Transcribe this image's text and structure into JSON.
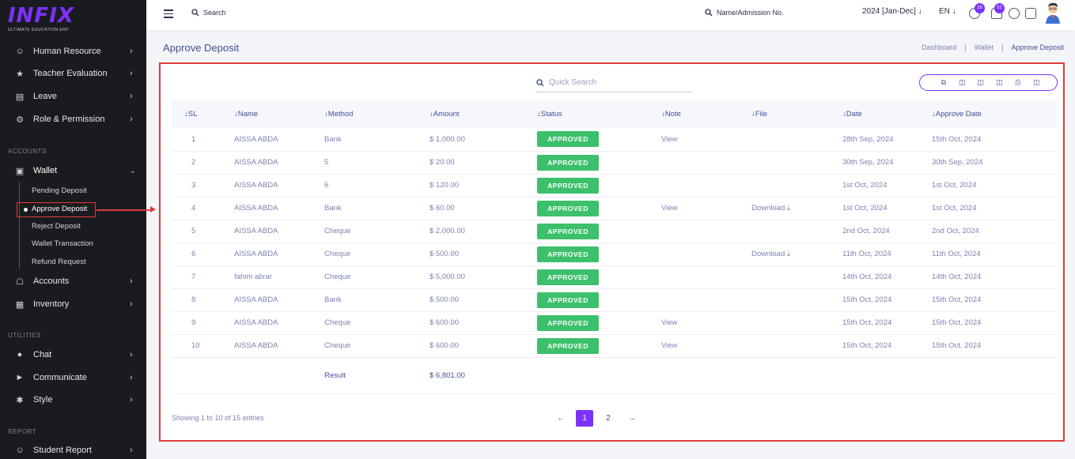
{
  "brand": {
    "name": "INFIX",
    "tagline": "ULTIMATE EDUCATION ERP",
    "accent": "#7c32ff"
  },
  "sidebar": {
    "items_top": [
      {
        "label": "Human Resource",
        "icon": "users-icon"
      },
      {
        "label": "Teacher Evaluation",
        "icon": "star-icon"
      },
      {
        "label": "Leave",
        "icon": "bed-icon"
      },
      {
        "label": "Role & Permission",
        "icon": "key-icon"
      }
    ],
    "section_accounts": "ACCOUNTS",
    "wallet": {
      "label": "Wallet",
      "icon": "wallet-icon"
    },
    "wallet_sub": [
      "Pending Deposit",
      "Approve Deposit",
      "Reject Deposit",
      "Wallet Transaction",
      "Refund Request"
    ],
    "items_accounts": [
      {
        "label": "Accounts",
        "icon": "bank-icon"
      },
      {
        "label": "Inventory",
        "icon": "box-icon"
      }
    ],
    "section_utilities": "UTILITIES",
    "items_utilities": [
      {
        "label": "Chat",
        "icon": "chat-icon"
      },
      {
        "label": "Communicate",
        "icon": "megaphone-icon"
      },
      {
        "label": "Style",
        "icon": "style-icon"
      }
    ],
    "section_report": "REPORT",
    "items_report": [
      {
        "label": "Student Report",
        "icon": "users-icon"
      }
    ]
  },
  "topbar": {
    "search_label": "Search",
    "student_search": "Name/Admission No.",
    "session": "2024 [Jan-Dec]",
    "language": "EN",
    "chat_count": "16",
    "notification_count": "52"
  },
  "page": {
    "title": "Approve Deposit",
    "breadcrumb": [
      "Dashboard",
      "Wallet",
      "Approve Deposit"
    ]
  },
  "table": {
    "quick_search_placeholder": "Quick Search",
    "headers": [
      "SL",
      "Name",
      "Method",
      "Amount",
      "Status",
      "Note",
      "File",
      "Date",
      "Approve Date"
    ],
    "rows": [
      {
        "sl": "1",
        "name": "AISSA ABDA",
        "method": "Bank",
        "amount": "$ 1,000.00",
        "status": "APPROVED",
        "note": "View",
        "file": "",
        "date": "28th Sep, 2024",
        "approve_date": "15th Oct, 2024"
      },
      {
        "sl": "2",
        "name": "AISSA ABDA",
        "method": "5",
        "amount": "$ 20.00",
        "status": "APPROVED",
        "note": "",
        "file": "",
        "date": "30th Sep, 2024",
        "approve_date": "30th Sep, 2024"
      },
      {
        "sl": "3",
        "name": "AISSA ABDA",
        "method": "6",
        "amount": "$ 120.00",
        "status": "APPROVED",
        "note": "",
        "file": "",
        "date": "1st Oct, 2024",
        "approve_date": "1st Oct, 2024"
      },
      {
        "sl": "4",
        "name": "AISSA ABDA",
        "method": "Bank",
        "amount": "$ 60.00",
        "status": "APPROVED",
        "note": "View",
        "file": "Download",
        "date": "1st Oct, 2024",
        "approve_date": "1st Oct, 2024"
      },
      {
        "sl": "5",
        "name": "AISSA ABDA",
        "method": "Cheque",
        "amount": "$ 2,000.00",
        "status": "APPROVED",
        "note": "",
        "file": "",
        "date": "2nd Oct, 2024",
        "approve_date": "2nd Oct, 2024"
      },
      {
        "sl": "6",
        "name": "AISSA ABDA",
        "method": "Cheque",
        "amount": "$ 500.00",
        "status": "APPROVED",
        "note": "",
        "file": "Download",
        "date": "11th Oct, 2024",
        "approve_date": "11th Oct, 2024"
      },
      {
        "sl": "7",
        "name": "fahim abrar",
        "method": "Cheque",
        "amount": "$ 5,000.00",
        "status": "APPROVED",
        "note": "",
        "file": "",
        "date": "14th Oct, 2024",
        "approve_date": "14th Oct, 2024"
      },
      {
        "sl": "8",
        "name": "AISSA ABDA",
        "method": "Bank",
        "amount": "$ 500.00",
        "status": "APPROVED",
        "note": "",
        "file": "",
        "date": "15th Oct, 2024",
        "approve_date": "15th Oct, 2024"
      },
      {
        "sl": "9",
        "name": "AISSA ABDA",
        "method": "Cheque",
        "amount": "$ 600.00",
        "status": "APPROVED",
        "note": "View",
        "file": "",
        "date": "15th Oct, 2024",
        "approve_date": "15th Oct, 2024"
      },
      {
        "sl": "10",
        "name": "AISSA ABDA",
        "method": "Cheque",
        "amount": "$ 600.00",
        "status": "APPROVED",
        "note": "View",
        "file": "",
        "date": "15th Oct, 2024",
        "approve_date": "15th Oct, 2024"
      }
    ],
    "result_label": "Result",
    "result_total": "$ 6,801.00",
    "showing": "Showing 1 to 10 of 15 entries",
    "pages": [
      "1",
      "2"
    ],
    "active_page": "1",
    "status_color": "#3cc06b"
  }
}
